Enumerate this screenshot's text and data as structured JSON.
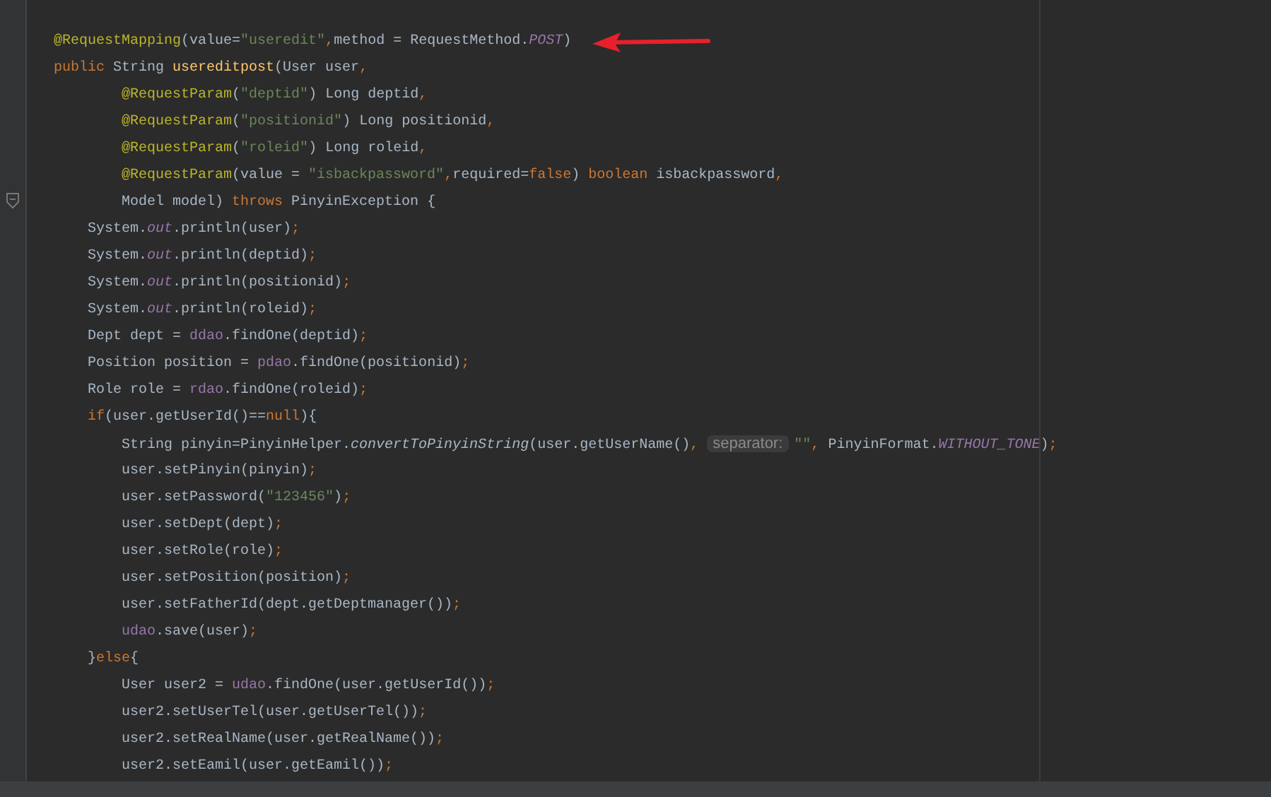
{
  "editor": {
    "lines": [
      {
        "tokens": [
          {
            "kind": "annotation",
            "text": "@RequestMapping"
          },
          {
            "kind": "plain",
            "text": "(value="
          },
          {
            "kind": "string",
            "text": "\"useredit\""
          },
          {
            "kind": "keyword",
            "text": ","
          },
          {
            "kind": "plain",
            "text": "method = RequestMethod."
          },
          {
            "kind": "static",
            "text": "POST"
          },
          {
            "kind": "plain",
            "text": ")"
          }
        ]
      },
      {
        "tokens": [
          {
            "kind": "keyword",
            "text": "public "
          },
          {
            "kind": "plain",
            "text": "String "
          },
          {
            "kind": "declaration",
            "text": "usereditpost"
          },
          {
            "kind": "plain",
            "text": "(User user"
          },
          {
            "kind": "keyword",
            "text": ","
          }
        ]
      },
      {
        "tokens": [
          {
            "kind": "annotation",
            "text": "        @RequestParam"
          },
          {
            "kind": "plain",
            "text": "("
          },
          {
            "kind": "string",
            "text": "\"deptid\""
          },
          {
            "kind": "plain",
            "text": ") Long deptid"
          },
          {
            "kind": "keyword",
            "text": ","
          }
        ]
      },
      {
        "tokens": [
          {
            "kind": "annotation",
            "text": "        @RequestParam"
          },
          {
            "kind": "plain",
            "text": "("
          },
          {
            "kind": "string",
            "text": "\"positionid\""
          },
          {
            "kind": "plain",
            "text": ") Long positionid"
          },
          {
            "kind": "keyword",
            "text": ","
          }
        ]
      },
      {
        "tokens": [
          {
            "kind": "annotation",
            "text": "        @RequestParam"
          },
          {
            "kind": "plain",
            "text": "("
          },
          {
            "kind": "string",
            "text": "\"roleid\""
          },
          {
            "kind": "plain",
            "text": ") Long roleid"
          },
          {
            "kind": "keyword",
            "text": ","
          }
        ]
      },
      {
        "tokens": [
          {
            "kind": "annotation",
            "text": "        @RequestParam"
          },
          {
            "kind": "plain",
            "text": "(value = "
          },
          {
            "kind": "string",
            "text": "\"isbackpassword\""
          },
          {
            "kind": "keyword",
            "text": ","
          },
          {
            "kind": "plain",
            "text": "required="
          },
          {
            "kind": "keyword",
            "text": "false"
          },
          {
            "kind": "plain",
            "text": ") "
          },
          {
            "kind": "keyword",
            "text": "boolean "
          },
          {
            "kind": "plain",
            "text": "isbackpassword"
          },
          {
            "kind": "keyword",
            "text": ","
          }
        ]
      },
      {
        "tokens": [
          {
            "kind": "plain",
            "text": "        Model model) "
          },
          {
            "kind": "keyword",
            "text": "throws "
          },
          {
            "kind": "plain",
            "text": "PinyinException {"
          }
        ]
      },
      {
        "tokens": [
          {
            "kind": "plain",
            "text": "    System."
          },
          {
            "kind": "static",
            "text": "out"
          },
          {
            "kind": "plain",
            "text": ".println(user)"
          },
          {
            "kind": "keyword",
            "text": ";"
          }
        ]
      },
      {
        "tokens": [
          {
            "kind": "plain",
            "text": "    System."
          },
          {
            "kind": "static",
            "text": "out"
          },
          {
            "kind": "plain",
            "text": ".println(deptid)"
          },
          {
            "kind": "keyword",
            "text": ";"
          }
        ]
      },
      {
        "tokens": [
          {
            "kind": "plain",
            "text": "    System."
          },
          {
            "kind": "static",
            "text": "out"
          },
          {
            "kind": "plain",
            "text": ".println(positionid)"
          },
          {
            "kind": "keyword",
            "text": ";"
          }
        ]
      },
      {
        "tokens": [
          {
            "kind": "plain",
            "text": "    System."
          },
          {
            "kind": "static",
            "text": "out"
          },
          {
            "kind": "plain",
            "text": ".println(roleid)"
          },
          {
            "kind": "keyword",
            "text": ";"
          }
        ]
      },
      {
        "tokens": [
          {
            "kind": "plain",
            "text": "    Dept dept = "
          },
          {
            "kind": "field",
            "text": "ddao"
          },
          {
            "kind": "plain",
            "text": ".findOne(deptid)"
          },
          {
            "kind": "keyword",
            "text": ";"
          }
        ]
      },
      {
        "tokens": [
          {
            "kind": "plain",
            "text": "    Position position = "
          },
          {
            "kind": "field",
            "text": "pdao"
          },
          {
            "kind": "plain",
            "text": ".findOne(positionid)"
          },
          {
            "kind": "keyword",
            "text": ";"
          }
        ]
      },
      {
        "tokens": [
          {
            "kind": "plain",
            "text": "    Role role = "
          },
          {
            "kind": "field",
            "text": "rdao"
          },
          {
            "kind": "plain",
            "text": ".findOne(roleid)"
          },
          {
            "kind": "keyword",
            "text": ";"
          }
        ]
      },
      {
        "tokens": [
          {
            "kind": "keyword",
            "text": "    if"
          },
          {
            "kind": "plain",
            "text": "(user.getUserId()=="
          },
          {
            "kind": "keyword",
            "text": "null"
          },
          {
            "kind": "plain",
            "text": "){"
          }
        ]
      },
      {
        "tokens": [
          {
            "kind": "plain",
            "text": "        String pinyin=PinyinHelper."
          },
          {
            "kind": "italic",
            "text": "convertToPinyinString"
          },
          {
            "kind": "plain",
            "text": "(user.getUserName()"
          },
          {
            "kind": "keyword",
            "text": ", "
          },
          {
            "kind": "hint",
            "text": "separator:"
          },
          {
            "kind": "string",
            "text": "\"\""
          },
          {
            "kind": "keyword",
            "text": ","
          },
          {
            "kind": "plain",
            "text": " PinyinFormat."
          },
          {
            "kind": "static",
            "text": "WITHOUT_TONE"
          },
          {
            "kind": "plain",
            "text": ")"
          },
          {
            "kind": "keyword",
            "text": ";"
          }
        ]
      },
      {
        "tokens": [
          {
            "kind": "plain",
            "text": "        user.setPinyin(pinyin)"
          },
          {
            "kind": "keyword",
            "text": ";"
          }
        ]
      },
      {
        "tokens": [
          {
            "kind": "plain",
            "text": "        user.setPassword("
          },
          {
            "kind": "string",
            "text": "\"123456\""
          },
          {
            "kind": "plain",
            "text": ")"
          },
          {
            "kind": "keyword",
            "text": ";"
          }
        ]
      },
      {
        "tokens": [
          {
            "kind": "plain",
            "text": "        user.setDept(dept)"
          },
          {
            "kind": "keyword",
            "text": ";"
          }
        ]
      },
      {
        "tokens": [
          {
            "kind": "plain",
            "text": "        user.setRole(role)"
          },
          {
            "kind": "keyword",
            "text": ";"
          }
        ]
      },
      {
        "tokens": [
          {
            "kind": "plain",
            "text": "        user.setPosition(position)"
          },
          {
            "kind": "keyword",
            "text": ";"
          }
        ]
      },
      {
        "tokens": [
          {
            "kind": "plain",
            "text": "        user.setFatherId(dept.getDeptmanager())"
          },
          {
            "kind": "keyword",
            "text": ";"
          }
        ]
      },
      {
        "tokens": [
          {
            "kind": "field",
            "text": "        udao"
          },
          {
            "kind": "plain",
            "text": ".save(user)"
          },
          {
            "kind": "keyword",
            "text": ";"
          }
        ]
      },
      {
        "tokens": [
          {
            "kind": "plain",
            "text": "    }"
          },
          {
            "kind": "keyword",
            "text": "else"
          },
          {
            "kind": "plain",
            "text": "{"
          }
        ]
      },
      {
        "tokens": [
          {
            "kind": "plain",
            "text": "        User user2 = "
          },
          {
            "kind": "field",
            "text": "udao"
          },
          {
            "kind": "plain",
            "text": ".findOne(user.getUserId())"
          },
          {
            "kind": "keyword",
            "text": ";"
          }
        ]
      },
      {
        "tokens": [
          {
            "kind": "plain",
            "text": "        user2.setUserTel(user.getUserTel())"
          },
          {
            "kind": "keyword",
            "text": ";"
          }
        ]
      },
      {
        "tokens": [
          {
            "kind": "plain",
            "text": "        user2.setRealName(user.getRealName())"
          },
          {
            "kind": "keyword",
            "text": ";"
          }
        ]
      },
      {
        "tokens": [
          {
            "kind": "plain",
            "text": "        user2.setEamil(user.getEamil())"
          },
          {
            "kind": "keyword",
            "text": ";"
          }
        ]
      }
    ]
  }
}
